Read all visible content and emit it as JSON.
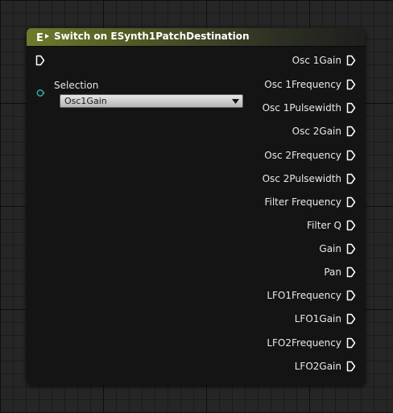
{
  "node": {
    "title": "Switch on ESynth1PatchDestination",
    "header_icon": "switch-enum-icon",
    "selection_label": "Selection",
    "selection_value": "Osc1Gain",
    "outputs": [
      {
        "label": "Osc 1Gain"
      },
      {
        "label": "Osc 1Frequency"
      },
      {
        "label": "Osc 1Pulsewidth"
      },
      {
        "label": "Osc 2Gain"
      },
      {
        "label": "Osc 2Frequency"
      },
      {
        "label": "Osc 2Pulsewidth"
      },
      {
        "label": "Filter Frequency"
      },
      {
        "label": "Filter Q"
      },
      {
        "label": "Gain"
      },
      {
        "label": "Pan"
      },
      {
        "label": "LFO1Frequency"
      },
      {
        "label": "LFO1Gain"
      },
      {
        "label": "LFO2Frequency"
      },
      {
        "label": "LFO2Gain"
      }
    ]
  },
  "colors": {
    "header_accent": "#6f7a2a",
    "selection_pin": "#2aa69a",
    "background": "#262626"
  }
}
